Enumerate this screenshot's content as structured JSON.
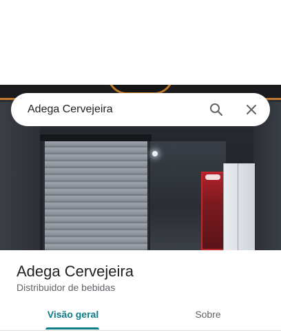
{
  "search": {
    "query": "Adega Cervejeira",
    "search_icon": "search-icon",
    "close_icon": "close-icon"
  },
  "place": {
    "name": "Adega Cervejeira",
    "category": "Distribuidor de bebidas",
    "photo": "storefront-photo"
  },
  "tabs": [
    {
      "label": "Visão geral",
      "selected": true
    },
    {
      "label": "Sobre",
      "selected": false
    }
  ],
  "colors": {
    "accent": "#0b7b87",
    "text_primary": "#202124",
    "text_secondary": "#5f6368"
  }
}
